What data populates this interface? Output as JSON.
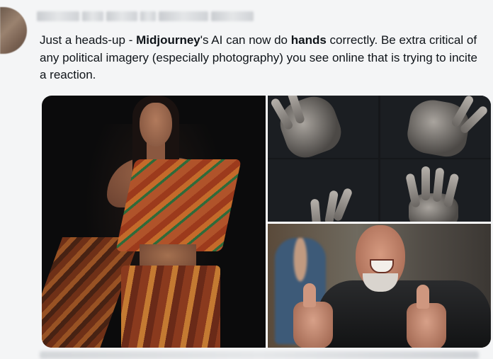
{
  "tweet": {
    "avatar_icon": "blurred-avatar",
    "author_name": "",
    "text": {
      "part1": "Just a heads-up - ",
      "bold1": "Midjourney",
      "part2": "'s AI can now do ",
      "bold2": "hands",
      "part3": " correctly. Be extra critical of any political imagery (especially photography) you see online that is trying to incite a reaction."
    },
    "media": {
      "images": [
        {
          "name": "woman-in-saree-photo"
        },
        {
          "name": "ai-hands-grid-photo"
        },
        {
          "name": "man-thumbs-up-photo"
        }
      ]
    }
  },
  "colors": {
    "background": "#f4f5f6",
    "text": "#0f1419"
  }
}
